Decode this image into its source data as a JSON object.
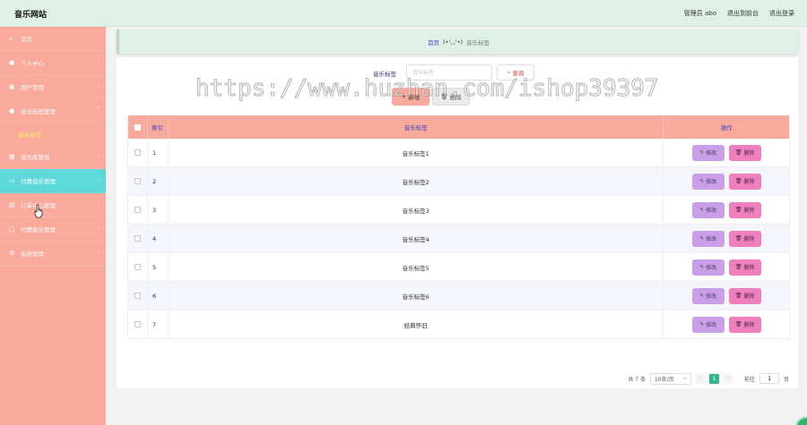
{
  "header": {
    "site_title": "音乐网站",
    "admin_label": "管理员 abo",
    "back_label": "退出到前台",
    "logout_label": "退出登录"
  },
  "sidebar": {
    "items": [
      {
        "label": "首页",
        "icon": "home-icon",
        "has_chevron": false
      },
      {
        "label": "个人中心",
        "icon": "user-icon",
        "has_chevron": true
      },
      {
        "label": "用户管理",
        "icon": "users-icon",
        "has_chevron": true
      },
      {
        "label": "音乐标签管理",
        "icon": "user-icon",
        "has_chevron": true,
        "expanded": true
      },
      {
        "label": "音乐库管理",
        "icon": "grid-icon",
        "has_chevron": true
      },
      {
        "label": "付费音乐管理",
        "icon": "folder-icon",
        "has_chevron": true,
        "active": true
      },
      {
        "label": "订单中心管理",
        "icon": "list-icon",
        "has_chevron": true
      },
      {
        "label": "付费音乐管理",
        "icon": "coin-icon",
        "has_chevron": true
      },
      {
        "label": "系统管理",
        "icon": "gear-icon",
        "has_chevron": true
      }
    ],
    "sub_item": "音乐标签"
  },
  "breadcrumb": {
    "home": "首页",
    "emoticon": "(•'◡'•)",
    "current": "音乐标签"
  },
  "search": {
    "label": "音乐标签",
    "placeholder": "音乐标签",
    "query_label": "查询"
  },
  "actions": {
    "add_label": "新增",
    "delete_label": "删除"
  },
  "table": {
    "headers": {
      "index": "索引",
      "tag": "音乐标签",
      "ops": "操作"
    },
    "rows": [
      {
        "index": "1",
        "tag": "音乐标签1"
      },
      {
        "index": "2",
        "tag": "音乐标签2"
      },
      {
        "index": "3",
        "tag": "音乐标签3"
      },
      {
        "index": "4",
        "tag": "音乐标签4"
      },
      {
        "index": "5",
        "tag": "音乐标签5"
      },
      {
        "index": "6",
        "tag": "音乐标签6"
      },
      {
        "index": "7",
        "tag": "经典怀旧"
      }
    ],
    "edit_label": "修改",
    "remove_label": "删除"
  },
  "pagination": {
    "total": "共 7 条",
    "page_size": "10条/页",
    "current_page": "1",
    "goto_prefix": "前往",
    "goto_value": "1",
    "goto_suffix": "页"
  },
  "watermark": "https://www.huzhan.com/ishop39397",
  "colors": {
    "header_bg": "#dff0e6",
    "sidebar_bg": "#f9aa9c",
    "active_item": "#5ed8d8",
    "edit_button": "#c9a0e8",
    "remove_button": "#f07fbf",
    "pager_active": "#35b58a"
  }
}
